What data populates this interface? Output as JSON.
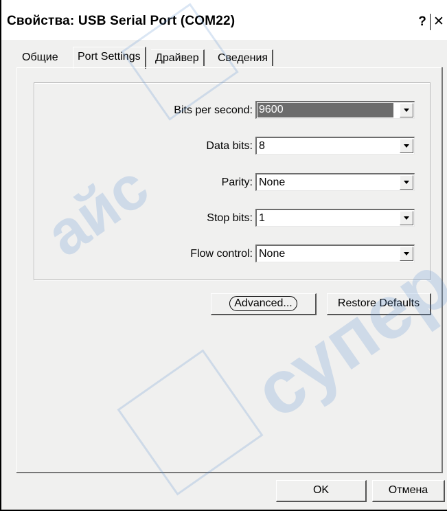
{
  "window": {
    "title": "Свойства: USB Serial Port (COM22)",
    "help_button": "?",
    "close_button": "✕"
  },
  "tabs": [
    {
      "label": "Общие",
      "active": false
    },
    {
      "label": "Port Settings",
      "active": true
    },
    {
      "label": "Драйвер",
      "active": false
    },
    {
      "label": "Сведения",
      "active": false
    }
  ],
  "settings": {
    "bits_per_second": {
      "label": "Bits per second:",
      "value": "9600",
      "selected": true
    },
    "data_bits": {
      "label": "Data bits:",
      "value": "8"
    },
    "parity": {
      "label": "Parity:",
      "value": "None"
    },
    "stop_bits": {
      "label": "Stop bits:",
      "value": "1"
    },
    "flow_control": {
      "label": "Flow control:",
      "value": "None"
    }
  },
  "buttons": {
    "advanced": "Advanced...",
    "restore_defaults": "Restore Defaults",
    "ok": "OK",
    "cancel": "Отмена"
  },
  "watermark": {
    "text": "суперайс",
    "color": "#5a8fd0"
  }
}
